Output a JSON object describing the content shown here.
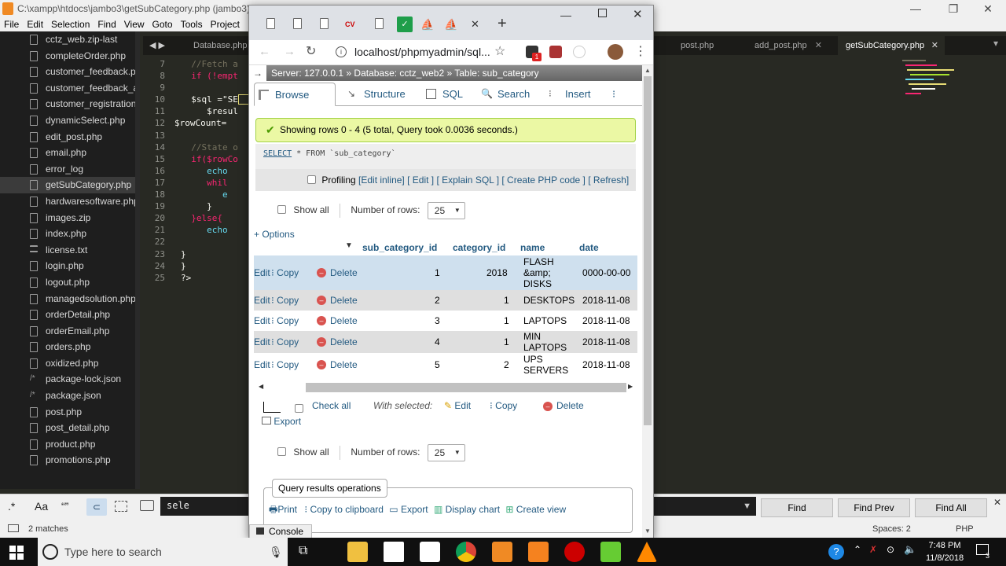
{
  "sublime": {
    "title": "C:\\xampp\\htdocs\\jambo3\\getSubCategory.php (jambo3) - Sublime Text (UNREGISTERED)",
    "title_visible": "C:\\xampp\\htdocs\\jambo3\\getSubCategory.php (jambo3)",
    "menu": [
      "File",
      "Edit",
      "Selection",
      "Find",
      "View",
      "Goto",
      "Tools",
      "Project"
    ],
    "files": [
      "cctz_web.zip-last",
      "completeOrder.php",
      "customer_feedback.ph",
      "customer_feedback_ac",
      "customer_registration.",
      "dynamicSelect.php",
      "edit_post.php",
      "email.php",
      "error_log",
      "getSubCategory.php",
      "hardwaresoftware.php",
      "images.zip",
      "index.php",
      "license.txt",
      "login.php",
      "logout.php",
      "managedsolution.php",
      "orderDetail.php",
      "orderEmail.php",
      "orders.php",
      "oxidized.php",
      "package-lock.json",
      "package.json",
      "post.php",
      "post_detail.php",
      "product.php",
      "promotions.php"
    ],
    "selected_file": "getSubCategory.php",
    "tabs": [
      "Database.php",
      "post.php",
      "add_post.php",
      "getSubCategory.php"
    ],
    "code": [
      {
        "n": "7",
        "t": "  //Fetch a"
      },
      {
        "n": "8",
        "t": "  if (!empt"
      },
      {
        "n": "9",
        "t": ""
      },
      {
        "n": "10",
        "t": "  $sql =\"SE"
      },
      {
        "n": "11",
        "t": "     $resul"
      },
      {
        "n": "12",
        "t": "$rowCount="
      },
      {
        "n": "13",
        "t": ""
      },
      {
        "n": "14",
        "t": "  //State o"
      },
      {
        "n": "15",
        "t": "  if($rowCo"
      },
      {
        "n": "16",
        "t": "     echo"
      },
      {
        "n": "17",
        "t": "     whil"
      },
      {
        "n": "18",
        "t": "        e"
      },
      {
        "n": "19",
        "t": "     }"
      },
      {
        "n": "20",
        "t": "  }else{"
      },
      {
        "n": "21",
        "t": "     echo"
      },
      {
        "n": "22",
        "t": ""
      },
      {
        "n": "23",
        "t": "}"
      },
      {
        "n": "24",
        "t": "}"
      },
      {
        "n": "25",
        "t": "?>"
      }
    ],
    "find": {
      "options": [
        ".*",
        "Aa",
        "“”"
      ],
      "value": "sele",
      "buttons": [
        "Find",
        "Find Prev",
        "Find All"
      ]
    },
    "status": {
      "matches": "2 matches",
      "spaces": "Spaces: 2",
      "syntax": "PHP"
    }
  },
  "chrome": {
    "url": "localhost/phpmyadmin/sql...",
    "badge": "1"
  },
  "pma": {
    "breadcrumb": "Server: 127.0.0.1 »  Database: cctz_web2 »  Table: sub_category",
    "tabs": [
      "Browse",
      "Structure",
      "SQL",
      "Search",
      "Insert"
    ],
    "success": "Showing rows 0 - 4 (5 total, Query took 0.0036 seconds.)",
    "sql": {
      "kw": "SELECT",
      "rest": " * FROM `sub_category`"
    },
    "profiling": {
      "label": "Profiling",
      "links": [
        "[Edit inline]",
        "[ Edit ]",
        "[ Explain SQL ]",
        "[ Create PHP code ]",
        "[ Refresh]"
      ]
    },
    "nav": {
      "show_all": "Show all",
      "rows_label": "Number of rows:",
      "rows_value": "25"
    },
    "options": "+ Options",
    "columns": [
      "sub_category_id",
      "category_id",
      "name",
      "date"
    ],
    "row_actions": {
      "edit": "Edit",
      "copy": "Copy",
      "delete": "Delete"
    },
    "rows": [
      {
        "id": "1",
        "cat": "2018",
        "name": "FLASH &amp; DISKS",
        "date": "0000-00-00"
      },
      {
        "id": "2",
        "cat": "1",
        "name": "DESKTOPS",
        "date": "2018-11-08"
      },
      {
        "id": "3",
        "cat": "1",
        "name": "LAPTOPS",
        "date": "2018-11-08"
      },
      {
        "id": "4",
        "cat": "1",
        "name": "MIN LAPTOPS",
        "date": "2018-11-08"
      },
      {
        "id": "5",
        "cat": "2",
        "name": "UPS SERVERS",
        "date": "2018-11-08"
      }
    ],
    "bulk": {
      "check_all": "Check all",
      "with_selected": "With selected:",
      "edit": "Edit",
      "copy": "Copy",
      "delete": "Delete",
      "export": "Export"
    },
    "qro": {
      "title": "Query results operations",
      "items": [
        "Print",
        "Copy to clipboard",
        "Export",
        "Display chart",
        "Create view"
      ]
    },
    "console": "Console"
  },
  "taskbar": {
    "search": "Type here to search",
    "time": "7:48 PM",
    "date": "11/8/2018",
    "notifications": "3"
  }
}
